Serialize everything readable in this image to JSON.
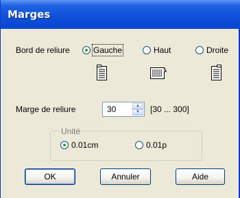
{
  "window": {
    "title": "Marges"
  },
  "binding_edge": {
    "label": "Bord de reliure",
    "options": [
      {
        "label": "Gauche",
        "selected": true,
        "icon": "left-bind-page-icon"
      },
      {
        "label": "Haut",
        "selected": false,
        "icon": "top-bind-page-icon"
      },
      {
        "label": "Droite",
        "selected": false,
        "icon": "right-bind-page-icon"
      }
    ]
  },
  "binding_margin": {
    "label": "Marge de reliure",
    "value": "30",
    "range": "[30 ... 300]"
  },
  "unit": {
    "title": "Unité",
    "options": [
      {
        "label": "0.01cm",
        "selected": true
      },
      {
        "label": "0.01p",
        "selected": false
      }
    ]
  },
  "buttons": {
    "ok": "OK",
    "cancel": "Annuler",
    "help": "Aide"
  },
  "colors": {
    "titlebar": "#0a46cf",
    "dialog_bg": "#ece9d8",
    "radio_dot": "#21a121"
  }
}
